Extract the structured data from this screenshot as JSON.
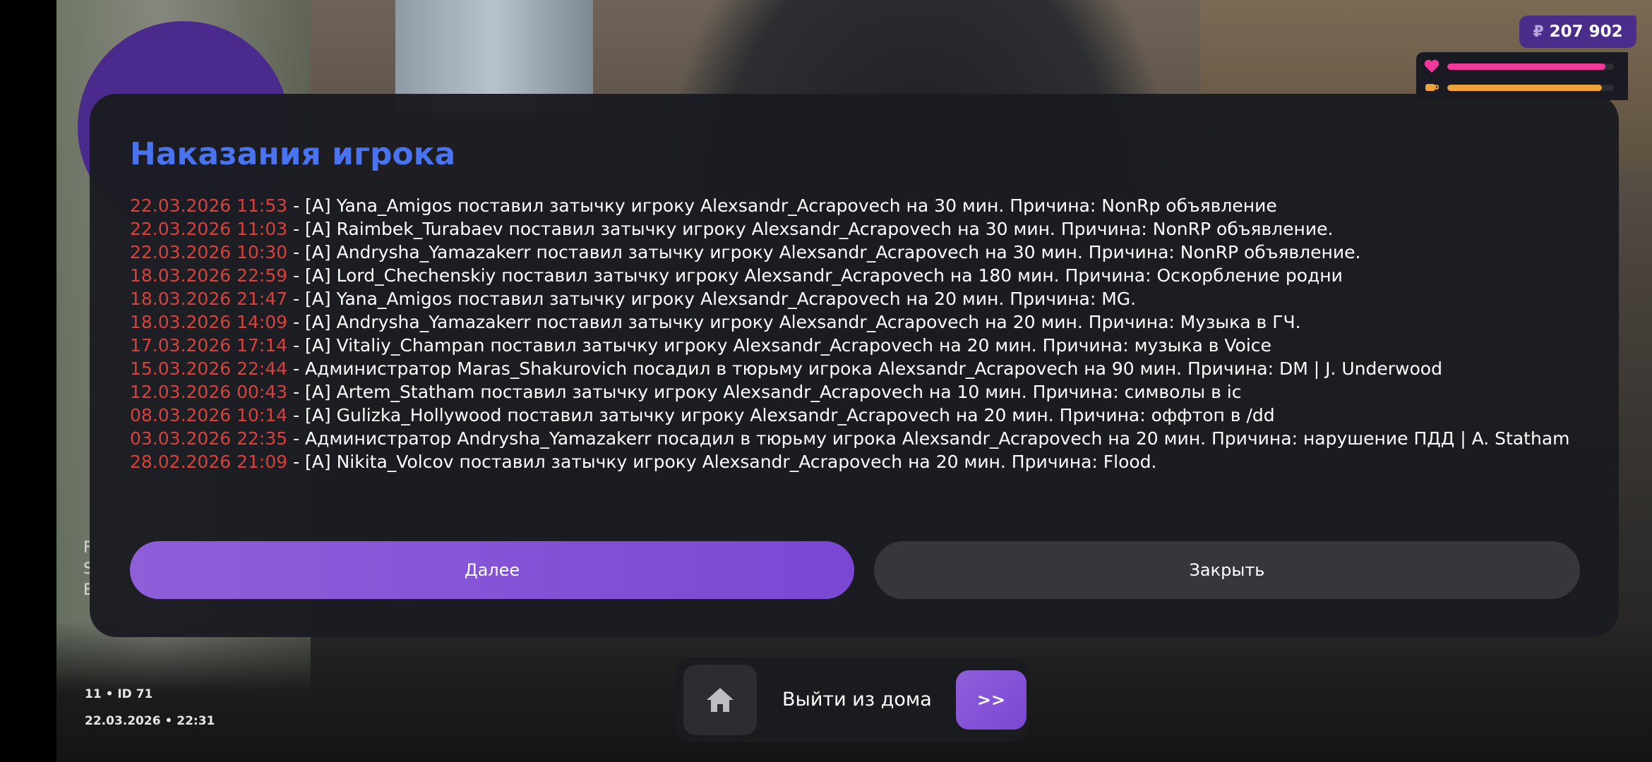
{
  "hud": {
    "money": {
      "currency_symbol": "₽",
      "amount": "207 902"
    },
    "stats": [
      {
        "icon": "heart-icon",
        "color": "#f0399a",
        "level": 0.95
      },
      {
        "icon": "food-icon",
        "color": "#f0a23a",
        "level": 0.93
      }
    ]
  },
  "dialog": {
    "title": "Наказания игрока",
    "entries": [
      {
        "date": "22.03.2026 11:53",
        "text": " - [A] Yana_Amigos поставил затычку игроку Alexsandr_Acrapovech на 30 мин. Причина: NonRp объявление"
      },
      {
        "date": "22.03.2026 11:03",
        "text": " - [A] Raimbek_Turabaev поставил затычку игроку Alexsandr_Acrapovech на 30 мин. Причина: NonRP объявление."
      },
      {
        "date": "22.03.2026 10:30",
        "text": " - [A] Andrysha_Yamazakerr поставил затычку игроку Alexsandr_Acrapovech на 30 мин. Причина: NonRP объявление."
      },
      {
        "date": "18.03.2026 22:59",
        "text": " - [A] Lord_Chechenskiy поставил затычку игроку Alexsandr_Acrapovech на 180 мин. Причина: Оскорбление родни"
      },
      {
        "date": "18.03.2026 21:47",
        "text": " - [A] Yana_Amigos поставил затычку игроку Alexsandr_Acrapovech на 20 мин. Причина: MG."
      },
      {
        "date": "18.03.2026 14:09",
        "text": " - [A] Andrysha_Yamazakerr поставил затычку игроку Alexsandr_Acrapovech на 20 мин. Причина: Музыка в ГЧ."
      },
      {
        "date": "17.03.2026 17:14",
        "text": " - [A] Vitaliy_Champan поставил затычку игроку Alexsandr_Acrapovech на 20 мин. Причина: музыка в Voice"
      },
      {
        "date": "15.03.2026 22:44",
        "text": " - Администратор Maras_Shakurovich посадил в тюрьму игрока Alexsandr_Acrapovech на 90 мин. Причина: DM | J. Underwood"
      },
      {
        "date": "12.03.2026 00:43",
        "text": " - [A] Artem_Statham поставил затычку игроку Alexsandr_Acrapovech на 10 мин. Причина: символы в ic"
      },
      {
        "date": "08.03.2026 10:14",
        "text": " - [A] Gulizka_Hollywood поставил затычку игроку Alexsandr_Acrapovech на 20 мин. Причина: оффтоп в /dd"
      },
      {
        "date": "03.03.2026 22:35",
        "text": " - Администратор Andrysha_Yamazakerr посадил в тюрьму игрока Alexsandr_Acrapovech на 20 мин. Причина: нарушение ПДД | A. Statham"
      },
      {
        "date": "28.02.2026 21:09",
        "text": " - [A] Nikita_Volcov поставил затычку игроку Alexsandr_Acrapovech на 20 мин. Причина: Flood."
      }
    ],
    "next_label": "Далее",
    "close_label": "Закрыть"
  },
  "side_text": [
    "F",
    "S",
    "E"
  ],
  "status": {
    "server_id": "11 • ID 71",
    "datetime": "22.03.2026 • 22:31"
  },
  "exit_prompt": {
    "label": "Выйти из дома",
    "go_label": ">>"
  }
}
